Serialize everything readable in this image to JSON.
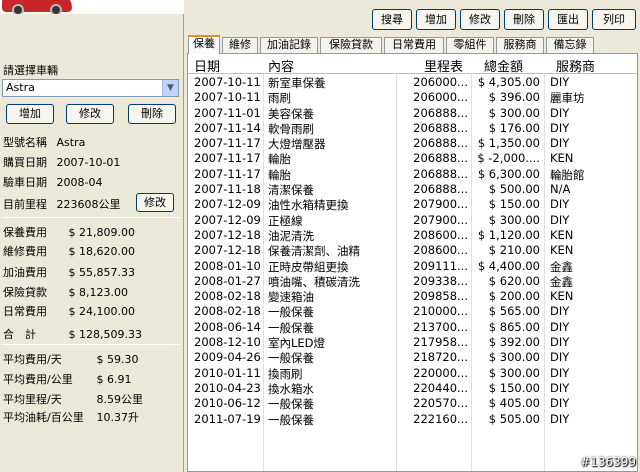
{
  "left": {
    "select_label": "請選擇車輛",
    "selected_car": "Astra",
    "buttons": {
      "add": "增加",
      "edit": "修改",
      "delete": "刪除"
    },
    "info": {
      "model_label": "型號名稱",
      "model_value": "Astra",
      "purchase_label": "購買日期",
      "purchase_value": "2007-10-01",
      "inspect_label": "驗車日期",
      "inspect_value": "2008-04",
      "mileage_label": "目前里程",
      "mileage_value": "223608公里",
      "mileage_edit": "修改"
    },
    "costs": [
      {
        "label": "保養費用",
        "value": "$ 21,809.00"
      },
      {
        "label": "維修費用",
        "value": "$ 18,620.00"
      },
      {
        "label": "加油費用",
        "value": "$ 55,857.33"
      },
      {
        "label": "保險貸款",
        "value": "$ 8,123.00"
      },
      {
        "label": "日常費用",
        "value": "$ 24,100.00"
      }
    ],
    "total_label": "合　計",
    "total_value": "$ 128,509.33",
    "averages": [
      {
        "label": "平均費用/天",
        "value": "$ 59.30"
      },
      {
        "label": "平均費用/公里",
        "value": "$ 6.91"
      },
      {
        "label": "平均里程/天",
        "value": "8.59公里"
      },
      {
        "label": "平均油耗/百公里",
        "value": "10.37升"
      }
    ]
  },
  "toolbar": {
    "search": "搜尋",
    "add": "增加",
    "edit": "修改",
    "delete": "刪除",
    "export": "匯出",
    "print": "列印"
  },
  "tabs": [
    "保養",
    "維修",
    "加油記錄",
    "保險貸款",
    "日常費用",
    "零組件",
    "服務商",
    "備忘錄"
  ],
  "grid": {
    "headers": [
      "日期",
      "內容",
      "里程表",
      "總金額",
      "服務商"
    ],
    "rows": [
      [
        "2007-10-11",
        "新室車保養",
        "206000...",
        "$ 4,305.00",
        "DIY"
      ],
      [
        "2007-10-11",
        "雨刷",
        "206000...",
        "$ 396.00",
        "麗車坊"
      ],
      [
        "2007-11-01",
        "美容保養",
        "206888...",
        "$ 300.00",
        "DIY"
      ],
      [
        "2007-11-14",
        "軟骨雨刷",
        "206888...",
        "$ 176.00",
        "DIY"
      ],
      [
        "2007-11-17",
        "大燈增壓器",
        "206888...",
        "$ 1,350.00",
        "DIY"
      ],
      [
        "2007-11-17",
        "輪胎",
        "206888...",
        "$ -2,000....",
        "KEN"
      ],
      [
        "2007-11-17",
        "輪胎",
        "206888...",
        "$ 6,300.00",
        "輪胎館"
      ],
      [
        "2007-11-18",
        "清潔保養",
        "206888...",
        "$ 500.00",
        "N/A"
      ],
      [
        "2007-12-09",
        "油性水箱精更換",
        "207900...",
        "$ 150.00",
        "DIY"
      ],
      [
        "2007-12-09",
        "正極線",
        "207900...",
        "$ 300.00",
        "DIY"
      ],
      [
        "2007-12-18",
        "油泥清洗",
        "208600...",
        "$ 1,120.00",
        "KEN"
      ],
      [
        "2007-12-18",
        "保養清潔劑、油精",
        "208600...",
        "$ 210.00",
        "KEN"
      ],
      [
        "2008-01-10",
        "正時皮帶組更換",
        "209111...",
        "$ 4,400.00",
        "金鑫"
      ],
      [
        "2008-01-27",
        "噴油嘴、積碳清洗",
        "209338...",
        "$ 620.00",
        "金鑫"
      ],
      [
        "2008-02-18",
        "變速箱油",
        "209858...",
        "$ 200.00",
        "KEN"
      ],
      [
        "2008-02-18",
        "一般保養",
        "210000...",
        "$ 565.00",
        "DIY"
      ],
      [
        "2008-06-14",
        "一般保養",
        "213700...",
        "$ 865.00",
        "DIY"
      ],
      [
        "2008-12-10",
        "室內LED燈",
        "217958...",
        "$ 392.00",
        "DIY"
      ],
      [
        "2009-04-26",
        "一般保養",
        "218720...",
        "$ 300.00",
        "DIY"
      ],
      [
        "2010-01-11",
        "換雨刷",
        "220000...",
        "$ 300.00",
        "DIY"
      ],
      [
        "2010-04-23",
        "換水箱水",
        "220440...",
        "$ 150.00",
        "DIY"
      ],
      [
        "2010-06-12",
        "一般保養",
        "220570...",
        "$ 405.00",
        "DIY"
      ],
      [
        "2011-07-19",
        "一般保養",
        "222160...",
        "$ 505.00",
        "DIY"
      ]
    ]
  },
  "watermark": "#136399"
}
